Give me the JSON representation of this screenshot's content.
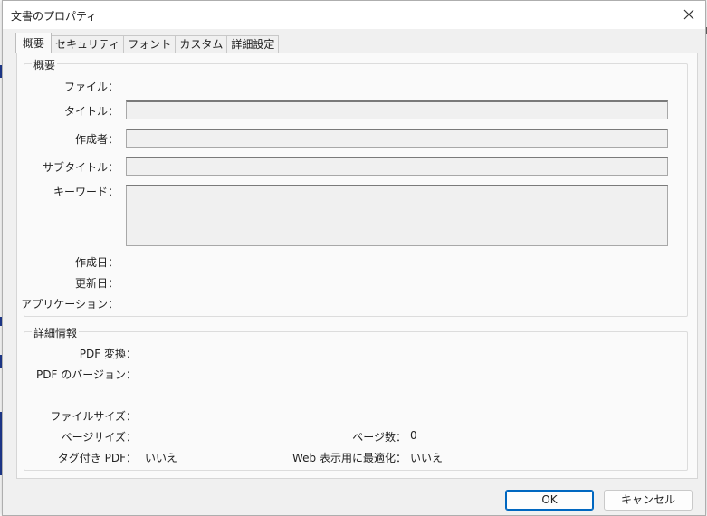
{
  "window": {
    "title": "文書のプロパティ",
    "close_icon": "close-icon"
  },
  "tabs": [
    {
      "label": "概要",
      "active": true
    },
    {
      "label": "セキュリティ",
      "active": false
    },
    {
      "label": "フォント",
      "active": false
    },
    {
      "label": "カスタム",
      "active": false
    },
    {
      "label": "詳細設定",
      "active": false
    }
  ],
  "overview": {
    "group_label": "概要",
    "file_label": "ファイル：",
    "title_label": "タイトル：",
    "title_value": "",
    "author_label": "作成者：",
    "author_value": "",
    "subtitle_label": "サブタイトル：",
    "subtitle_value": "",
    "keywords_label": "キーワード：",
    "keywords_value": "",
    "created_label": "作成日：",
    "modified_label": "更新日：",
    "application_label": "アプリケーション："
  },
  "details": {
    "group_label": "詳細情報",
    "pdf_producer_label": "PDF 変換：",
    "pdf_version_label": "PDF のバージョン：",
    "file_size_label": "ファイルサイズ：",
    "page_size_label": "ページサイズ：",
    "page_count_label": "ページ数：",
    "page_count_value": "0",
    "tagged_pdf_label": "タグ付き PDF：",
    "tagged_pdf_value": "いいえ",
    "fast_web_label": "Web 表示用に最適化：",
    "fast_web_value": "いいえ"
  },
  "buttons": {
    "ok": "OK",
    "cancel": "キャンセル"
  }
}
